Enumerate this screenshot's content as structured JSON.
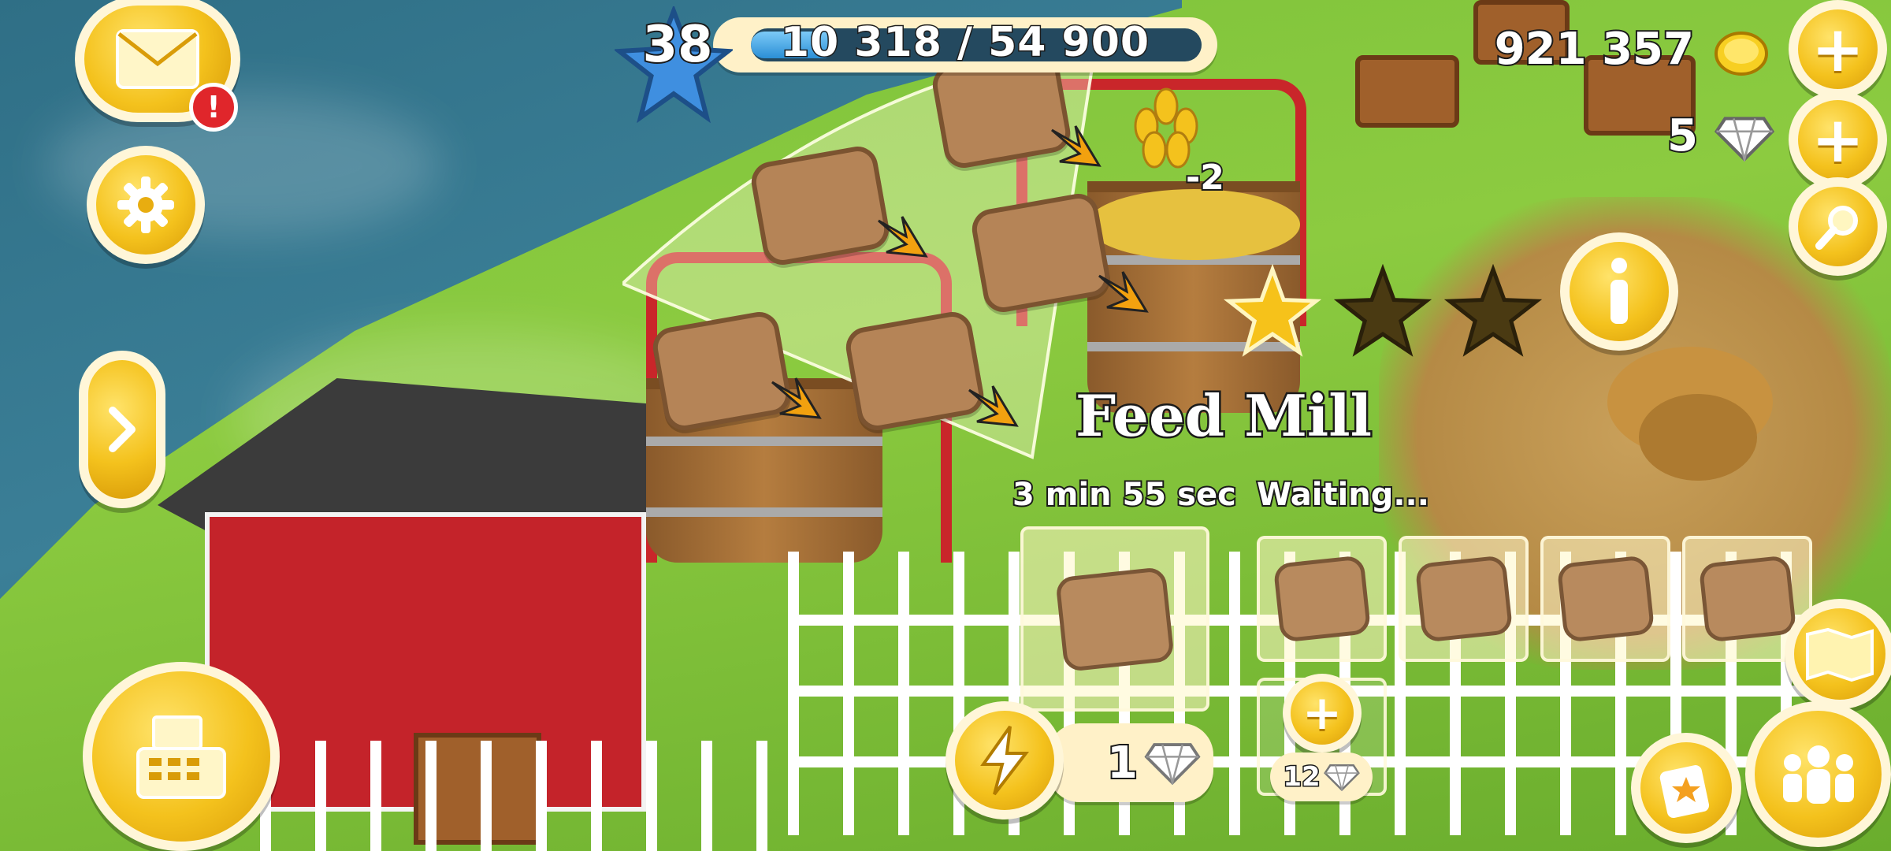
{
  "colors": {
    "accent": "#f4c21d",
    "bar_fill": "#2b8fd6",
    "alert": "#e0262b"
  },
  "player": {
    "level": "38",
    "xp_text": "10 318 / 54 900",
    "xp_fraction": 0.188
  },
  "currency": {
    "coins": "921 357",
    "diamonds": "5"
  },
  "building": {
    "name": "Feed Mill",
    "timer": "3 min 55 sec",
    "queue_status": "Waiting...",
    "stars_earned": 1,
    "stars_total": 3,
    "grain_cost": "-2",
    "skip_cost": "1",
    "unlock_slot_cost": "12",
    "queue_items": [
      "chicken-feed",
      "chicken-feed",
      "chicken-feed",
      "chicken-feed"
    ],
    "in_progress_item": "chicken-feed",
    "recipes": [
      "sheep-feed",
      "pig-feed",
      "chicken-feed",
      "goat-feed",
      "cow-feed"
    ]
  },
  "icons": {
    "mail": "envelope-icon",
    "settings": "gear-icon",
    "expand": "chevron-right-icon",
    "shop": "cash-register-icon",
    "info": "info-icon",
    "search": "magnifier-icon",
    "skip": "lightning-icon",
    "friends": "friends-icon",
    "cards": "card-icon",
    "map": "map-icon"
  },
  "mail": {
    "badge": "!"
  }
}
